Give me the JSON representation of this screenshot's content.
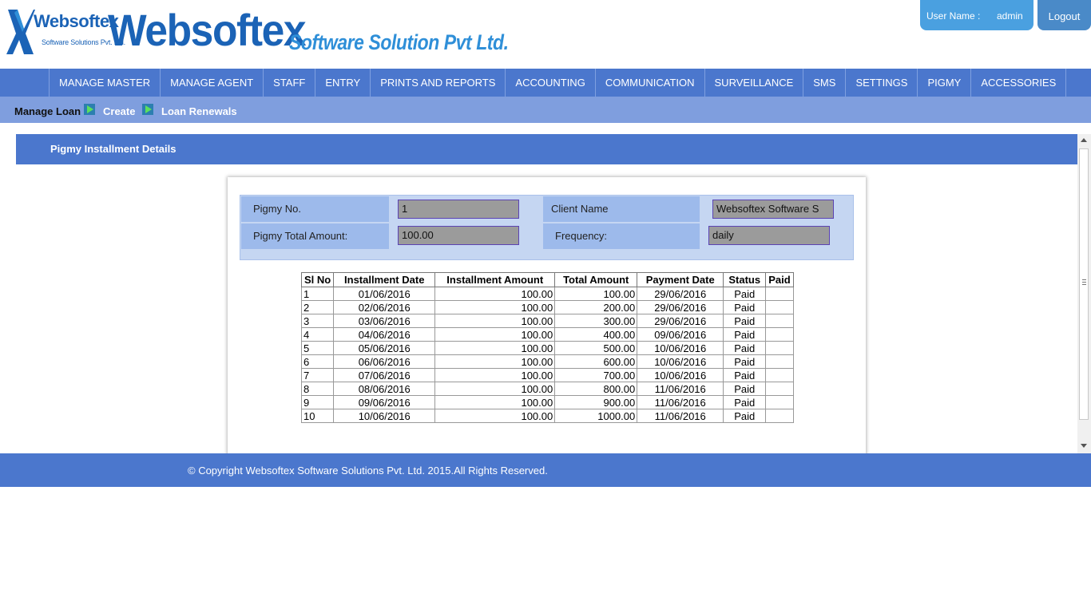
{
  "brand": {
    "small_name": "Websoftex",
    "small_sub": "Software Solutions Pvt. Ltd.",
    "big_name": "Websoftex",
    "big_sub": "Software Solution Pvt Ltd.",
    "colors": {
      "primary": "#1b63b6",
      "secondary": "#2f8fd8",
      "nav": "#4b77cd"
    }
  },
  "user": {
    "label": "User Name :",
    "name": "admin",
    "logout_label": "Logout"
  },
  "nav": {
    "items": [
      {
        "label": "MANAGE MASTER"
      },
      {
        "label": "MANAGE AGENT"
      },
      {
        "label": "STAFF"
      },
      {
        "label": "ENTRY"
      },
      {
        "label": "PRINTS AND REPORTS"
      },
      {
        "label": "ACCOUNTING"
      },
      {
        "label": "COMMUNICATION"
      },
      {
        "label": "SURVEILLANCE"
      },
      {
        "label": "SMS"
      },
      {
        "label": "SETTINGS"
      },
      {
        "label": "PIGMY"
      },
      {
        "label": "ACCESSORIES"
      }
    ]
  },
  "subnav": {
    "manage_loan": "Manage Loan",
    "create": "Create",
    "loan_renewals": "Loan Renewals"
  },
  "section": {
    "title": "Pigmy Installment Details"
  },
  "form": {
    "pigmy_no_label": "Pigmy No.",
    "pigmy_no_value": "1",
    "client_name_label": "Client Name",
    "client_name_value": "Websoftex Software S",
    "total_amount_label": "Pigmy Total Amount:",
    "total_amount_value": "100.00",
    "frequency_label": "Frequency:",
    "frequency_value": "daily"
  },
  "table": {
    "headers": [
      "Sl No",
      "Installment Date",
      "Installment Amount",
      "Total Amount",
      "Payment Date",
      "Status",
      "Paid"
    ],
    "rows": [
      [
        "1",
        "01/06/2016",
        "100.00",
        "100.00",
        "29/06/2016",
        "Paid",
        ""
      ],
      [
        "2",
        "02/06/2016",
        "100.00",
        "200.00",
        "29/06/2016",
        "Paid",
        ""
      ],
      [
        "3",
        "03/06/2016",
        "100.00",
        "300.00",
        "29/06/2016",
        "Paid",
        ""
      ],
      [
        "4",
        "04/06/2016",
        "100.00",
        "400.00",
        "09/06/2016",
        "Paid",
        ""
      ],
      [
        "5",
        "05/06/2016",
        "100.00",
        "500.00",
        "10/06/2016",
        "Paid",
        ""
      ],
      [
        "6",
        "06/06/2016",
        "100.00",
        "600.00",
        "10/06/2016",
        "Paid",
        ""
      ],
      [
        "7",
        "07/06/2016",
        "100.00",
        "700.00",
        "10/06/2016",
        "Paid",
        ""
      ],
      [
        "8",
        "08/06/2016",
        "100.00",
        "800.00",
        "11/06/2016",
        "Paid",
        ""
      ],
      [
        "9",
        "09/06/2016",
        "100.00",
        "900.00",
        "11/06/2016",
        "Paid",
        ""
      ],
      [
        "10",
        "10/06/2016",
        "100.00",
        "1000.00",
        "11/06/2016",
        "Paid",
        ""
      ]
    ]
  },
  "footer": {
    "copyright": "© Copyright Websoftex Software Solutions Pvt. Ltd. 2015.All Rights Reserved."
  }
}
